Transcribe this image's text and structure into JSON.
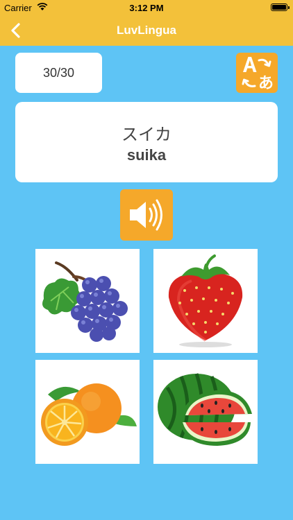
{
  "status_bar": {
    "carrier": "Carrier",
    "time": "3:12 PM"
  },
  "nav": {
    "title": "LuvLingua",
    "back_icon": "chevron-left-icon"
  },
  "progress": {
    "label": "30/30"
  },
  "word": {
    "japanese": "スイカ",
    "romaji": "suika"
  },
  "icons": {
    "translate": "translate-icon",
    "sound": "speaker-icon"
  },
  "choices": [
    "grapes",
    "strawberry",
    "orange",
    "watermelon"
  ],
  "colors": {
    "accent": "#f3c13a",
    "button": "#f5a82a",
    "background": "#5ec4f5"
  }
}
